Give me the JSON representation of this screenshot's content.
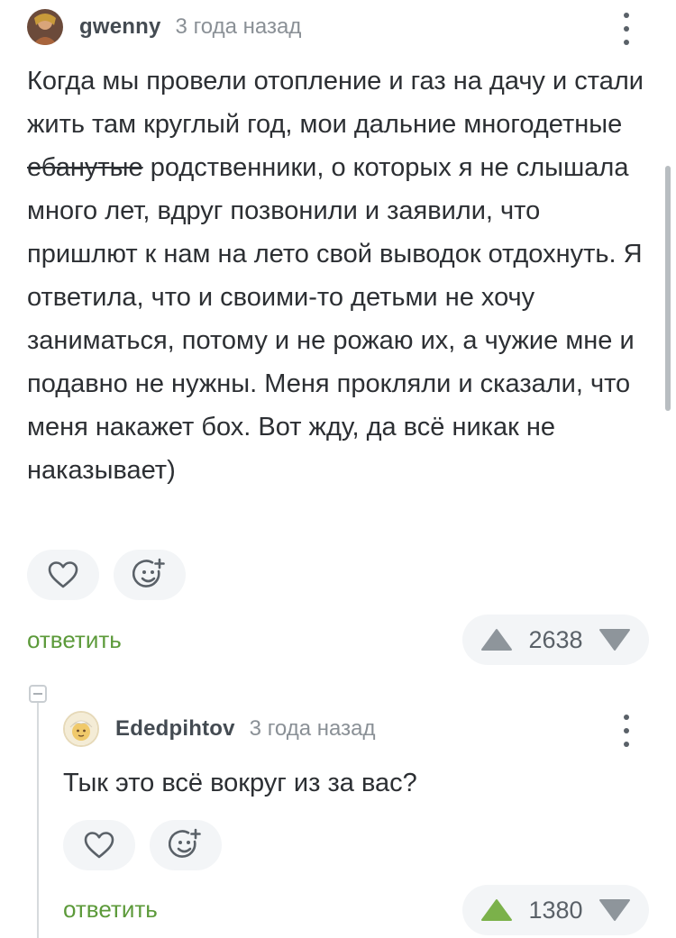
{
  "comments": [
    {
      "username": "gwenny",
      "timestamp": "3 года назад",
      "text_before": "Когда мы провели отопление и газ на дачу и стали жить там круглый год, мои дальние многодетные ",
      "text_struck": "ебанутые",
      "text_after": " родственники, о которых я не слышала много лет, вдруг позвонили и заявили, что пришлют к нам на лето свой выводок отдохнуть. Я ответила, что и своими-то детьми не хочу заниматься, потому и не рожаю их, а чужие мне и подавно не нужны. Меня прокляли и сказали, что меня накажет бох. Вот жду, да всё никак не наказывает)",
      "reply_label": "ответить",
      "rating": "2638",
      "upvoted": false
    },
    {
      "username": "Ededpihtov",
      "timestamp": "3 года назад",
      "text": "Тык это всё вокруг из за вас?",
      "reply_label": "ответить",
      "rating": "1380",
      "upvoted": true
    }
  ],
  "colors": {
    "accent_green": "#5c9a3a",
    "upvote_active": "#7bb14a",
    "vote_inactive": "#8e959b",
    "pill_bg": "#f3f5f7"
  },
  "icons": [
    "heart-icon",
    "add-reaction-icon",
    "upvote-icon",
    "downvote-icon",
    "more-vertical-icon",
    "collapse-thread-icon"
  ]
}
